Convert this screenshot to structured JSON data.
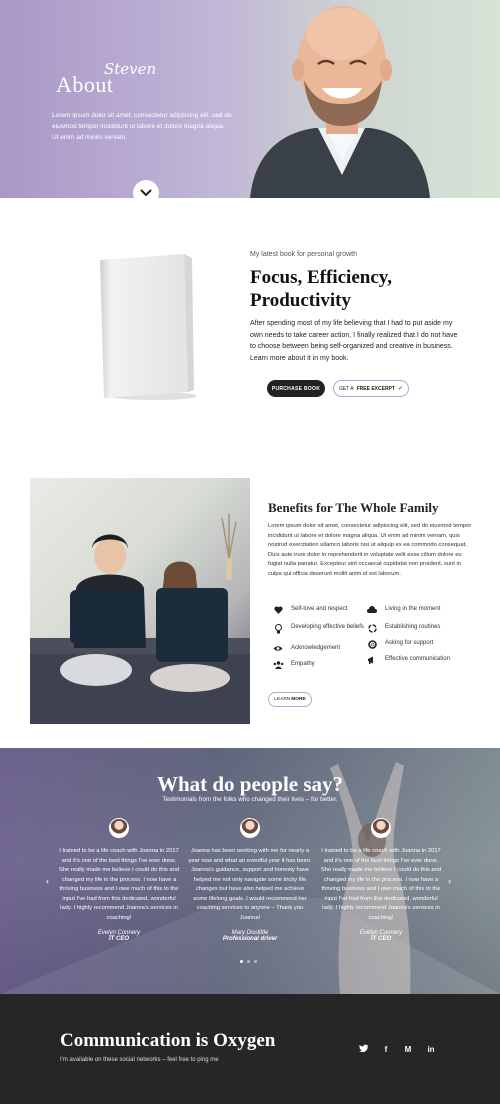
{
  "hero": {
    "title": "About",
    "script_name": "Steven",
    "text": "Lorem ipsum dolor sit amet, consectetur adipiscing elit, sed do eiusmod tempor incididunt ut labore et dolore magna aliqua. Ut enim ad minim veniam."
  },
  "book": {
    "kicker": "My latest book for personal growth",
    "title": "Focus, Efficiency, Productivity",
    "description": "After spending most of my life believing that I had to put aside my own needs to take career action, I finally realized that I do not have to choose between being self-organized and creative in business. Learn more about it in my book.",
    "purchase_label": "PURCHASE BOOK",
    "excerpt_prefix": "GET A",
    "excerpt_bold": "FREE EXCERPT"
  },
  "family": {
    "heading_prefix": "Benefits for",
    "heading_bold": "The Whole Family",
    "body": "Lorem ipsum dolor sit amet, consectetur adipiscing elit, sed do eiusmod tempor incididunt ut labore et dolore magna aliqua. Ut enim ad minim veniam, quis nostrud exercitation ullamco laboris nisi ut aliquip ex ea commodo consequat. Duis aute irure dolor in reprehenderit in voluptate velit esse cillum dolore eu fugiat nulla pariatur. Excepteur sint occaecat cupidatat non proident, sunt in culpa qui officia deserunt mollit anim id est laborum.",
    "features": [
      {
        "label": "Self-love and respect",
        "icon": "heart-icon"
      },
      {
        "label": "Living in the moment",
        "icon": "cloud-icon"
      },
      {
        "label": "Developing effective beliefs",
        "icon": "lightbulb-icon"
      },
      {
        "label": "Establishing routines",
        "icon": "recycle-icon"
      },
      {
        "label": "Acknowledgement",
        "icon": "eye-icon"
      },
      {
        "label": "Asking for support",
        "icon": "lifebuoy-icon"
      },
      {
        "label": "Empathy",
        "icon": "users-icon"
      },
      {
        "label": "Effective communication",
        "icon": "megaphone-icon"
      }
    ],
    "learn_prefix": "LEARN",
    "learn_bold": "MORE"
  },
  "testimonials": {
    "title": "What do people say?",
    "subtitle": "Testimonials from the folks who changed their lives – for better.",
    "cards": [
      {
        "quote": "I trained to be a life coach with Joanna in 2017 and it's one of the best things I've ever done. She really made me believe I could do this and changed my life in the process. I now have a thriving business and I owe much of this to the input I've had from this dedicated, wonderful lady. I highly recommend Joanna's services in coaching!",
        "name": "Evelyn Connery",
        "role": "IT CEO"
      },
      {
        "quote": "Joanna has been working with me for nearly a year now and what an eventful year it has been. Joanna's guidance, support and honesty have helped me not only navigate some tricky life changes but have also helped me achieve some lifelong goals. I would recommend her coaching services to anyone – Thank you Joanna!",
        "name": "Mary Doolittle",
        "role": "Professional driver"
      },
      {
        "quote": "I trained to be a life coach with Joanna in 2017 and it's one of the best things I've ever done. She really made me believe I could do this and changed my life in the process. I now have a thriving business and I owe much of this to the input I've had from this dedicated, wonderful lady. I highly recommend Joanna's services in coaching!",
        "name": "Evelyn Connery",
        "role": "IT CEO"
      }
    ]
  },
  "footer": {
    "title": "Communication is Oxygen",
    "subtitle": "I'm available on these social networks – feel free to ping me",
    "socials": [
      "twitter-icon",
      "facebook-icon",
      "medium-icon",
      "linkedin-icon"
    ]
  },
  "colors": {
    "accent_lavender": "#b6a8d3",
    "dark": "#262626",
    "button_dark": "#222222"
  }
}
